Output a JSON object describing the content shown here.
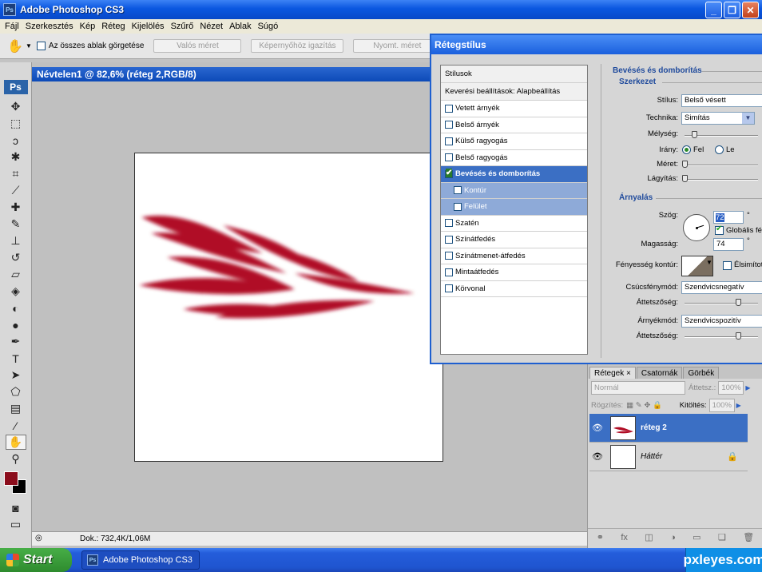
{
  "window": {
    "title": "Adobe Photoshop CS3",
    "logo": "Ps"
  },
  "menu": [
    "Fájl",
    "Szerkesztés",
    "Kép",
    "Réteg",
    "Kijelölés",
    "Szűrő",
    "Nézet",
    "Ablak",
    "Súgó"
  ],
  "options": {
    "tool_icon": "hand-icon",
    "scroll_all_label": "Az összes ablak görgetése",
    "btn_actual": "Valós méret",
    "btn_fit": "Képernyőhöz igazítás",
    "btn_print": "Nyomt. méret"
  },
  "toolbox": {
    "logo": "Ps"
  },
  "document": {
    "title": "Névtelen1 @ 82,6% (réteg 2,RGB/8)",
    "doc_size": "Dok.: 732,4K/1,06M",
    "fg_color": "#8b0d1c",
    "bg_color": "#000000"
  },
  "dialog": {
    "title": "Rétegstílus",
    "styles_header": "Stílusok",
    "blend_options": "Keverési beállítások: Alapbeállítás",
    "items": [
      {
        "label": "Vetett árnyék",
        "checked": false
      },
      {
        "label": "Belső árnyék",
        "checked": false
      },
      {
        "label": "Külső ragyogás",
        "checked": false
      },
      {
        "label": "Belső ragyogás",
        "checked": false
      },
      {
        "label": "Bevésés és domborítás",
        "checked": true
      },
      {
        "label": "Kontúr",
        "checked": false
      },
      {
        "label": "Felület",
        "checked": false
      },
      {
        "label": "Szatén",
        "checked": false
      },
      {
        "label": "Színátfedés",
        "checked": false
      },
      {
        "label": "Színátmenet-átfedés",
        "checked": false
      },
      {
        "label": "Mintaátfedés",
        "checked": false
      },
      {
        "label": "Körvonal",
        "checked": false
      }
    ],
    "bevel": {
      "section": "Bevésés és domborítás",
      "structure": "Szerkezet",
      "style_label": "Stílus:",
      "style_value": "Belső vésett",
      "technique_label": "Technika:",
      "technique_value": "Simítás",
      "depth_label": "Mélység:",
      "direction_label": "Irány:",
      "dir_up": "Fel",
      "dir_down": "Le",
      "size_label": "Méret:",
      "soften_label": "Lágyítás:"
    },
    "shading": {
      "section": "Árnyalás",
      "angle_label": "Szög:",
      "angle_value": "72",
      "degree": "°",
      "global_light": "Globális fény",
      "altitude_label": "Magasság:",
      "altitude_value": "74",
      "gloss_label": "Fényesség kontúr:",
      "antialias": "Élsimított",
      "highlight_label": "Csúcsfénymód:",
      "highlight_value": "Szendvicsnegatív",
      "opacity_label": "Áttetszőség:",
      "shadow_label": "Árnyékmód:",
      "shadow_value": "Szendvicspozitív",
      "opacity2_label": "Áttetszőség:"
    }
  },
  "layers_panel": {
    "tabs": [
      "Rétegek",
      "Csatornák",
      "Görbék"
    ],
    "tab_close": "×",
    "blend_mode": "Normál",
    "opacity_label": "Áttetsz.:",
    "opacity_value": "100%",
    "lock_label": "Rögzítés:",
    "fill_label": "Kitöltés:",
    "fill_value": "100%",
    "layers": [
      {
        "name": "réteg 2"
      },
      {
        "name": "Háttér"
      }
    ]
  },
  "taskbar": {
    "start": "Start",
    "task": "Adobe Photoshop CS3",
    "task_logo": "Ps",
    "tray": "pxleyes.com"
  }
}
